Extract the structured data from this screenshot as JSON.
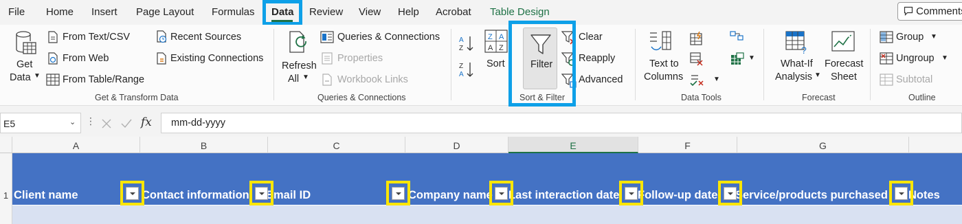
{
  "menu": {
    "tabs": [
      "File",
      "Home",
      "Insert",
      "Page Layout",
      "Formulas",
      "Data",
      "Review",
      "View",
      "Help",
      "Acrobat",
      "Table Design"
    ],
    "active": "Data",
    "comments_label": "Comments"
  },
  "ribbon": {
    "get_transform": {
      "get_data": [
        "Get",
        "Data"
      ],
      "from_text_csv": "From Text/CSV",
      "from_web": "From Web",
      "from_table_range": "From Table/Range",
      "recent_sources": "Recent Sources",
      "existing_connections": "Existing Connections",
      "group_label": "Get & Transform Data"
    },
    "queries": {
      "refresh_all": [
        "Refresh",
        "All"
      ],
      "queries_connections": "Queries & Connections",
      "properties": "Properties",
      "workbook_links": "Workbook Links",
      "group_label": "Queries & Connections"
    },
    "sort_filter": {
      "sort": "Sort",
      "filter": "Filter",
      "clear": "Clear",
      "reapply": "Reapply",
      "advanced": "Advanced",
      "group_label": "Sort & Filter"
    },
    "data_tools": {
      "text_to_columns": [
        "Text to",
        "Columns"
      ],
      "group_label": "Data Tools"
    },
    "forecast": {
      "what_if": [
        "What-If",
        "Analysis"
      ],
      "forecast_sheet": [
        "Forecast",
        "Sheet"
      ],
      "group_label": "Forecast"
    },
    "outline": {
      "group": "Group",
      "ungroup": "Ungroup",
      "subtotal": "Subtotal",
      "group_label": "Outline"
    }
  },
  "formula_bar": {
    "name_box": "E5",
    "fx": "fx",
    "formula": "mm-dd-yyyy"
  },
  "sheet": {
    "columns": [
      "A",
      "B",
      "C",
      "D",
      "E",
      "F",
      "G"
    ],
    "selected_column": "E",
    "row_numbers": [
      "1"
    ],
    "header_cells": [
      "Client name",
      "Contact information",
      "Email ID",
      "Company name",
      "Last interaction date",
      "Follow-up date",
      "Service/products purchased",
      "Notes"
    ]
  },
  "colors": {
    "table_header": "#4472c4",
    "table_band": "#d9e1f2",
    "highlight_blue": "#0ea0e8",
    "highlight_yellow": "#ffe600",
    "excel_green": "#1e7145"
  }
}
